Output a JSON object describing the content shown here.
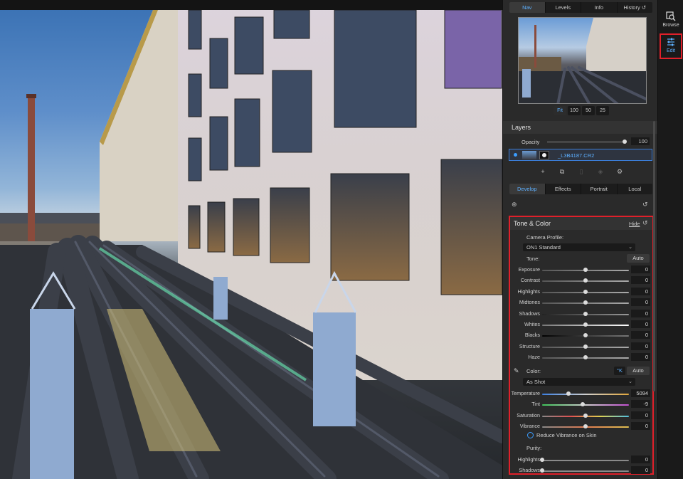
{
  "nav": {
    "tabs": [
      {
        "label": "Nav"
      },
      {
        "label": "Levels"
      },
      {
        "label": "Info"
      },
      {
        "label": "History"
      }
    ],
    "zoom": [
      "Fit",
      "100",
      "50",
      "25"
    ]
  },
  "layers": {
    "title": "Layers",
    "opacity_label": "Opacity",
    "opacity_value": "100",
    "layer_name": "_L3B4187.CR2"
  },
  "develop_tabs": [
    {
      "label": "Develop"
    },
    {
      "label": "Effects"
    },
    {
      "label": "Portrait"
    },
    {
      "label": "Local"
    }
  ],
  "tone_color": {
    "title": "Tone & Color",
    "hide_label": "Hide",
    "camera_profile_label": "Camera Profile:",
    "camera_profile_value": "ON1 Standard",
    "tone_label": "Tone:",
    "auto_label": "Auto",
    "tone_sliders": [
      {
        "label": "Exposure",
        "value": "0",
        "pos": 0.5
      },
      {
        "label": "Contrast",
        "value": "0",
        "pos": 0.5
      },
      {
        "label": "Highlights",
        "value": "0",
        "pos": 0.5
      },
      {
        "label": "Midtones",
        "value": "0",
        "pos": 0.5
      },
      {
        "label": "Shadows",
        "value": "0",
        "pos": 0.5
      },
      {
        "label": "Whites",
        "value": "0",
        "pos": 0.5
      },
      {
        "label": "Blacks",
        "value": "0",
        "pos": 0.5
      },
      {
        "label": "Structure",
        "value": "0",
        "pos": 0.5
      },
      {
        "label": "Haze",
        "value": "0",
        "pos": 0.5
      }
    ],
    "color_label": "Color:",
    "k_label": "°K",
    "color_auto_label": "Auto",
    "wb_value": "As Shot",
    "color_sliders": [
      {
        "label": "Temperature",
        "value": "5094",
        "pos": 0.3
      },
      {
        "label": "Tint",
        "value": "-9",
        "pos": 0.47
      },
      {
        "label": "Saturation",
        "value": "0",
        "pos": 0.5
      },
      {
        "label": "Vibrance",
        "value": "0",
        "pos": 0.5
      }
    ],
    "reduce_vibrance_label": "Reduce Vibrance on Skin",
    "purity_label": "Purity:",
    "purity_sliders": [
      {
        "label": "Highlights",
        "value": "0",
        "pos": 0.0
      },
      {
        "label": "Shadows",
        "value": "0",
        "pos": 0.0
      }
    ]
  },
  "toolstrip": {
    "browse_label": "Browse",
    "edit_label": "Edit"
  },
  "colors": {
    "accent": "#5db0ff",
    "highlight_border": "#e0202a"
  }
}
